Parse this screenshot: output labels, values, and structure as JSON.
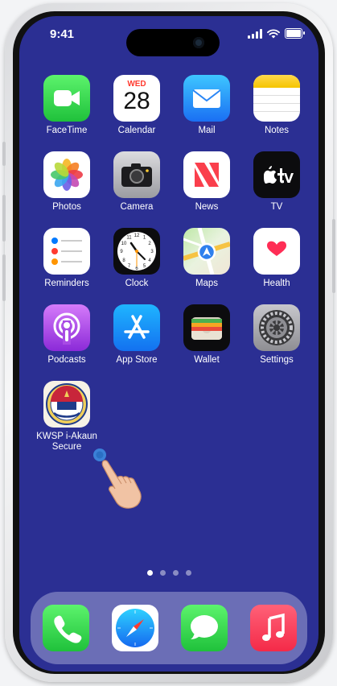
{
  "status_bar": {
    "time": "9:41"
  },
  "calendar": {
    "weekday": "WED",
    "day": "28"
  },
  "apps": [
    {
      "label": "FaceTime"
    },
    {
      "label": "Calendar"
    },
    {
      "label": "Mail"
    },
    {
      "label": "Notes"
    },
    {
      "label": "Photos"
    },
    {
      "label": "Camera"
    },
    {
      "label": "News"
    },
    {
      "label": "TV"
    },
    {
      "label": "Reminders"
    },
    {
      "label": "Clock"
    },
    {
      "label": "Maps"
    },
    {
      "label": "Health"
    },
    {
      "label": "Podcasts"
    },
    {
      "label": "App Store"
    },
    {
      "label": "Wallet"
    },
    {
      "label": "Settings"
    }
  ],
  "kwsp": {
    "line1": "KWSP i-Akaun",
    "line2": "Secure"
  },
  "page_dots": {
    "count": 4,
    "active": 1
  },
  "dock": {
    "apps": [
      "phone-icon",
      "safari-icon",
      "messages-icon",
      "music-icon"
    ]
  },
  "colors": {
    "wallpaper": "#2b2f93",
    "pointer_dot": "#3d8be0"
  }
}
